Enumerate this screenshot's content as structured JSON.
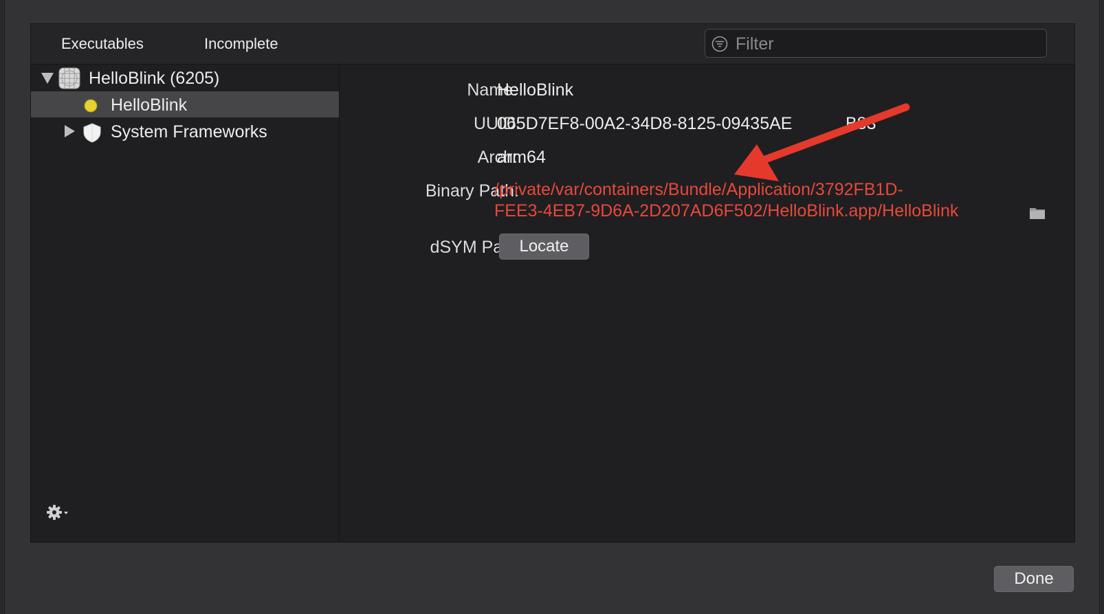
{
  "tabs": [
    "Executables",
    "Incomplete"
  ],
  "filter": {
    "placeholder": "Filter",
    "value": ""
  },
  "sidebar": {
    "items": [
      {
        "label": "HelloBlink (6205)",
        "icon": "app-grid-icon",
        "expanded": true
      },
      {
        "label": "HelloBlink",
        "icon": "yellow-dot-icon",
        "selected": true
      },
      {
        "label": "System Frameworks",
        "icon": "shield-icon",
        "expanded": false
      }
    ]
  },
  "details": {
    "name_label": "Name:",
    "name_value": "HelloBlink",
    "uuid_label": "UUID:",
    "uuid_value": "065D7EF8-00A2-34D8-8125-09435AE",
    "uuid_value_tail": "B83",
    "arch_label": "Arch:",
    "arch_value": "arm64",
    "binary_label": "Binary Path:",
    "binary_line1": "/private/var/containers/Bundle/Application/3792FB1D-",
    "binary_line2": "FEE3-4EB7-9D6A-2D207AD6F502/HelloBlink.app/HelloBlink",
    "dsym_label": "dSYM Path:",
    "locate_label": "Locate"
  },
  "footer": {
    "done_label": "Done"
  },
  "colors": {
    "path_red": "#e8483a",
    "arrow_red": "#e5392b",
    "dot_yellow": "#e8d230"
  }
}
